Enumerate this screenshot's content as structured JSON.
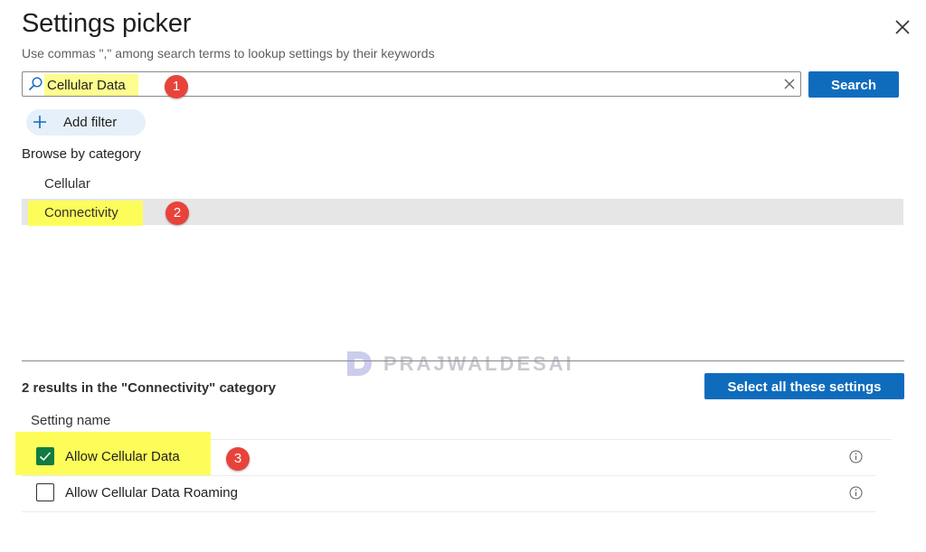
{
  "panel": {
    "title": "Settings picker",
    "subtitle": "Use commas \",\" among search terms to lookup settings by their keywords"
  },
  "search": {
    "value": "Cellular Data",
    "button_label": "Search"
  },
  "filter": {
    "add_label": "Add filter"
  },
  "browse": {
    "label": "Browse by category",
    "categories": [
      {
        "label": "Cellular",
        "selected": false
      },
      {
        "label": "Connectivity",
        "selected": true
      }
    ]
  },
  "results": {
    "summary": "2 results in the \"Connectivity\" category",
    "select_all_label": "Select all these settings",
    "column_header": "Setting name",
    "rows": [
      {
        "label": "Allow Cellular Data",
        "checked": true
      },
      {
        "label": "Allow Cellular Data Roaming",
        "checked": false
      }
    ]
  },
  "annotations": {
    "badge_1": "1",
    "badge_2": "2",
    "badge_3": "3"
  },
  "watermark": {
    "text": "PRAJWALDESAI"
  },
  "colors": {
    "accent": "#0f6cbd",
    "checkbox_checked": "#107c41",
    "highlight": "#fdfd5a",
    "annotation_badge": "#e8433a",
    "selected_row_bg": "#e6e6e6"
  },
  "icons": {
    "search": "search-icon",
    "clear": "clear-icon",
    "close": "close-icon",
    "add": "plus-icon",
    "check": "checkmark-icon",
    "info": "info-icon"
  }
}
